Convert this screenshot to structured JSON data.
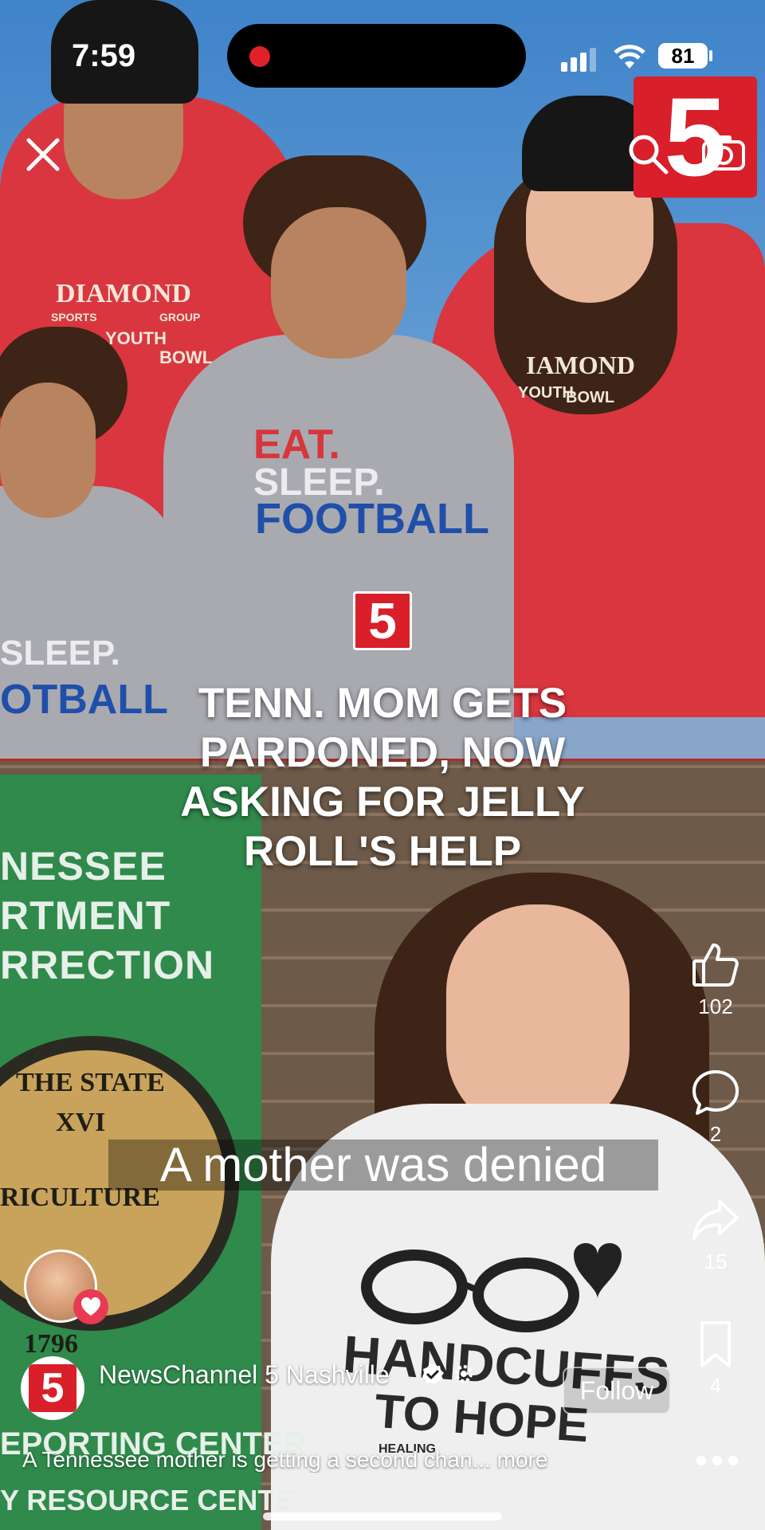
{
  "status_bar": {
    "time": "7:59",
    "battery": "81"
  },
  "branding": {
    "logo_big_text": "5",
    "logo_mid_text": "5",
    "author_logo_text": "5",
    "accent_color": "#d81f2a"
  },
  "headline": {
    "lines": [
      "TENN. MOM GETS",
      "PARDONED, NOW",
      "ASKING FOR JELLY",
      "ROLL'S HELP"
    ]
  },
  "caption": "A mother was denied",
  "photo_text": {
    "hoodie_man": [
      "DIAMOND",
      "SPORTS",
      "GROUP",
      "YOUTH",
      "BOWL"
    ],
    "hoodie_boy": [
      "EAT.",
      "SLEEP.",
      "FOOTBALL"
    ],
    "hoodie_left_boy": [
      "SLEEP.",
      "OTBALL"
    ],
    "hoodie_woman": [
      "IAMOND",
      "YOUTH",
      "BOWL"
    ],
    "sign": [
      "NESSEE",
      "RTMENT",
      "RRECTION"
    ],
    "seal": [
      "THE STATE",
      "XVI",
      "RICULTURE",
      "1796"
    ],
    "sign_bottom": [
      "EPORTING CENTER",
      "Y RESOURCE CENTE"
    ],
    "shirt": [
      "HANDCUFFS",
      "TO HOPE",
      "HEALING"
    ]
  },
  "actions": [
    {
      "name": "like",
      "icon": "thumbs-up-icon",
      "count": "102"
    },
    {
      "name": "comment",
      "icon": "comment-icon",
      "count": "2"
    },
    {
      "name": "share",
      "icon": "share-icon",
      "count": "15"
    },
    {
      "name": "save",
      "icon": "bookmark-icon",
      "count": "4"
    }
  ],
  "author": {
    "name": "NewsChannel 5 Nashville",
    "follow_label": "Follow"
  },
  "description": "A Tennessee mother is getting a second chan... more"
}
